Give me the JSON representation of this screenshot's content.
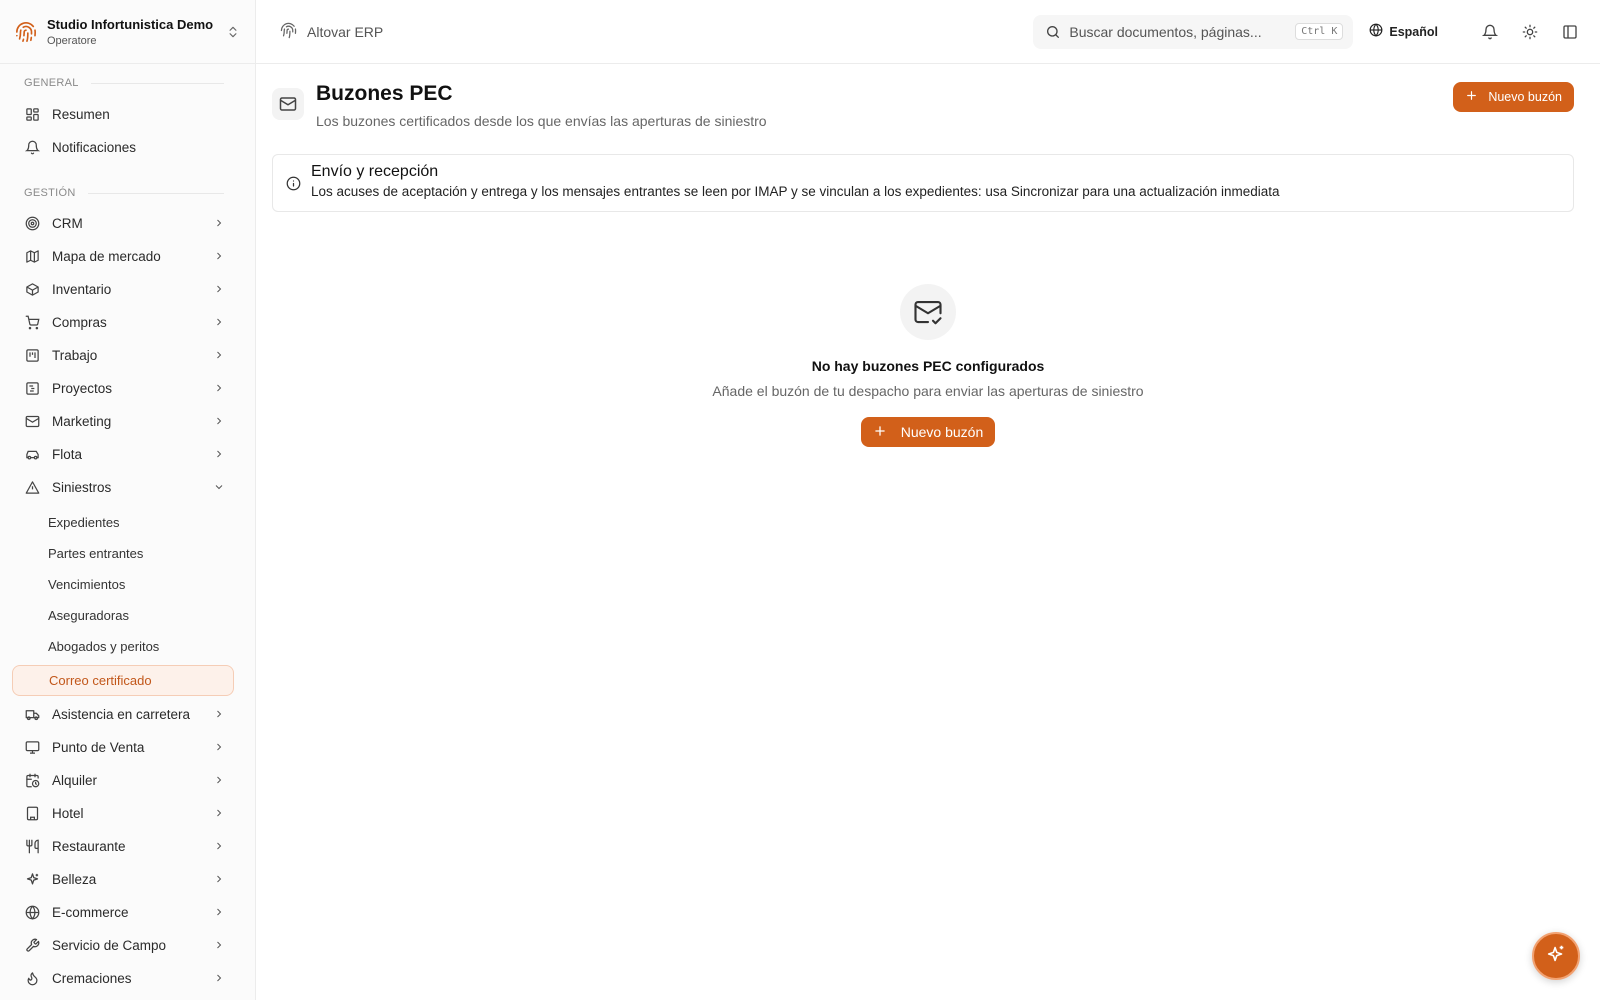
{
  "org": {
    "name": "Studio Infortunistica Demo",
    "role": "Operatore"
  },
  "sidebar": {
    "general_label": "GENERAL",
    "management_label": "GESTIÓN",
    "general_items": [
      {
        "label": "Resumen",
        "icon": "dashboard-icon"
      },
      {
        "label": "Notificaciones",
        "icon": "bell-icon"
      }
    ],
    "items": [
      {
        "label": "CRM",
        "icon": "target-icon"
      },
      {
        "label": "Mapa de mercado",
        "icon": "map-icon"
      },
      {
        "label": "Inventario",
        "icon": "package-icon"
      },
      {
        "label": "Compras",
        "icon": "cart-icon"
      },
      {
        "label": "Trabajo",
        "icon": "kanban-icon"
      },
      {
        "label": "Proyectos",
        "icon": "gantt-icon"
      },
      {
        "label": "Marketing",
        "icon": "mail-icon"
      },
      {
        "label": "Flota",
        "icon": "car-icon"
      },
      {
        "label": "Siniestros",
        "icon": "warning-icon",
        "expanded": true
      }
    ],
    "sub_items": [
      "Expedientes",
      "Partes entrantes",
      "Vencimientos",
      "Aseguradoras",
      "Abogados y peritos",
      "Correo certificado"
    ],
    "active_sub": "Correo certificado",
    "items_after": [
      {
        "label": "Asistencia en carretera",
        "icon": "truck-icon"
      },
      {
        "label": "Punto de Venta",
        "icon": "monitor-icon"
      },
      {
        "label": "Alquiler",
        "icon": "calendar-clock-icon"
      },
      {
        "label": "Hotel",
        "icon": "building-icon"
      },
      {
        "label": "Restaurante",
        "icon": "utensils-icon"
      },
      {
        "label": "Belleza",
        "icon": "sparkle-icon"
      },
      {
        "label": "E-commerce",
        "icon": "globe-icon"
      },
      {
        "label": "Servicio de Campo",
        "icon": "wrench-icon"
      },
      {
        "label": "Cremaciones",
        "icon": "flame-icon"
      }
    ]
  },
  "topbar": {
    "app_name": "Altovar ERP",
    "search_placeholder": "Buscar documentos, páginas...",
    "shortcut": "Ctrl K",
    "language": "Español"
  },
  "page": {
    "title": "Buzones PEC",
    "subtitle": "Los buzones certificados desde los que envías las aperturas de siniestro",
    "new_button": "Nuevo buzón"
  },
  "info": {
    "title": "Envío y recepción",
    "body": "Los acuses de aceptación y entrega y los mensajes entrantes se leen por IMAP y se vinculan a los expedientes: usa Sincronizar para una actualización inmediata"
  },
  "empty": {
    "title": "No hay buzones PEC configurados",
    "subtitle": "Añade el buzón de tu despacho para enviar las aperturas de siniestro",
    "button": "Nuevo buzón"
  },
  "colors": {
    "accent": "#d2601a",
    "active_bg": "#fdf1ea"
  }
}
